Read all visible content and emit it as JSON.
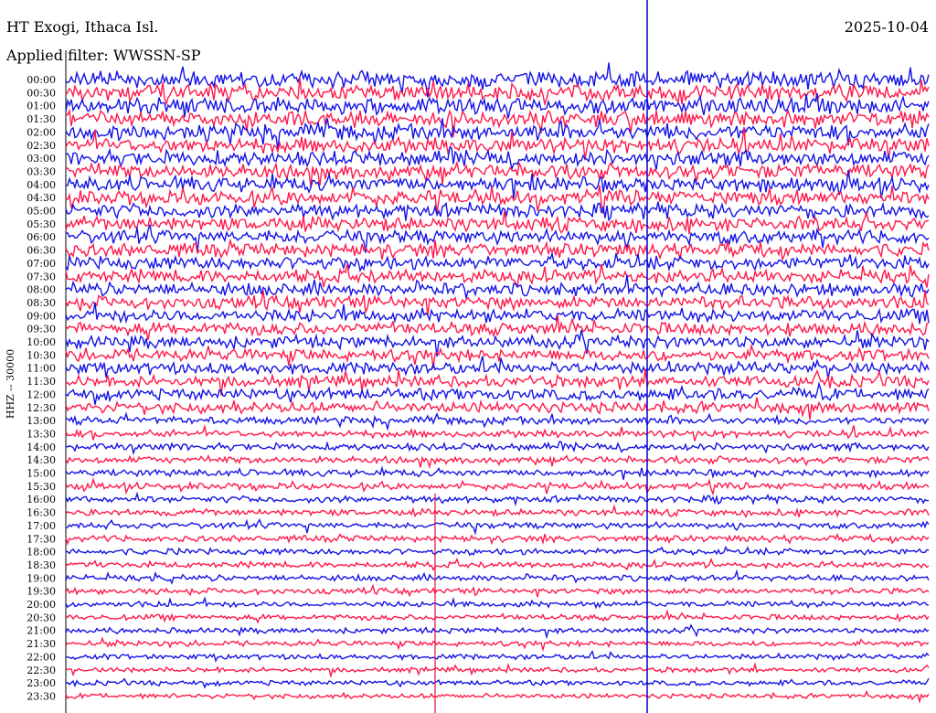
{
  "header": {
    "title": "HT Exogi, Ithaca Isl.",
    "date": "2025-10-04",
    "filter_label": "Applied filter: WWSSN-SP",
    "channel_label": "HHZ -- 30000"
  },
  "colors": {
    "trace_a": "#1414e6",
    "trace_b": "#ff1a4a",
    "marker": "#0000cc",
    "axis": "#000000",
    "event": "#e0103a"
  },
  "chart_data": {
    "type": "line",
    "y_ticks": [
      "00:00",
      "00:30",
      "01:00",
      "01:30",
      "02:00",
      "02:30",
      "03:00",
      "03:30",
      "04:00",
      "04:30",
      "05:00",
      "05:30",
      "06:00",
      "06:30",
      "07:00",
      "07:30",
      "08:00",
      "08:30",
      "09:00",
      "09:30",
      "10:00",
      "10:30",
      "11:00",
      "11:30",
      "12:00",
      "12:30",
      "13:00",
      "13:30",
      "14:00",
      "14:30",
      "15:00",
      "15:30",
      "16:00",
      "16:30",
      "17:00",
      "17:30",
      "18:00",
      "18:30",
      "19:00",
      "19:30",
      "20:00",
      "20:30",
      "21:00",
      "21:30",
      "22:00",
      "22:30",
      "23:00",
      "23:30"
    ],
    "ylabel": "HHZ -- 30000",
    "grid": false
  }
}
